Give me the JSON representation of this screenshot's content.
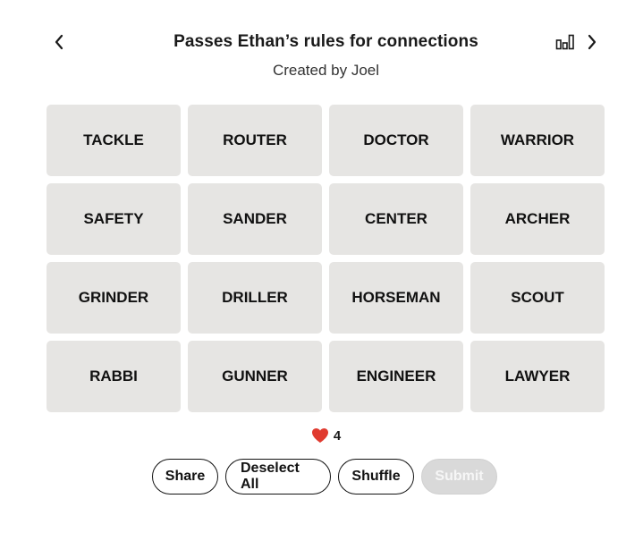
{
  "header": {
    "title": "Passes Ethan’s rules for connections",
    "subtitle": "Created by Joel",
    "back_icon": "chevron-left-icon",
    "stats_icon": "bar-chart-icon",
    "next_icon": "chevron-right-icon"
  },
  "grid": {
    "tiles": [
      "TACKLE",
      "ROUTER",
      "DOCTOR",
      "WARRIOR",
      "SAFETY",
      "SANDER",
      "CENTER",
      "ARCHER",
      "GRINDER",
      "DRILLER",
      "HORSEMAN",
      "SCOUT",
      "RABBI",
      "GUNNER",
      "ENGINEER",
      "LAWYER"
    ],
    "tile_color": "#e6e5e3"
  },
  "mistakes": {
    "icon": "heart-icon",
    "heart_color": "#e03a2f",
    "count": "4"
  },
  "actions": {
    "share_label": "Share",
    "deselect_label": "Deselect All",
    "shuffle_label": "Shuffle",
    "submit_label": "Submit",
    "submit_disabled": true
  }
}
